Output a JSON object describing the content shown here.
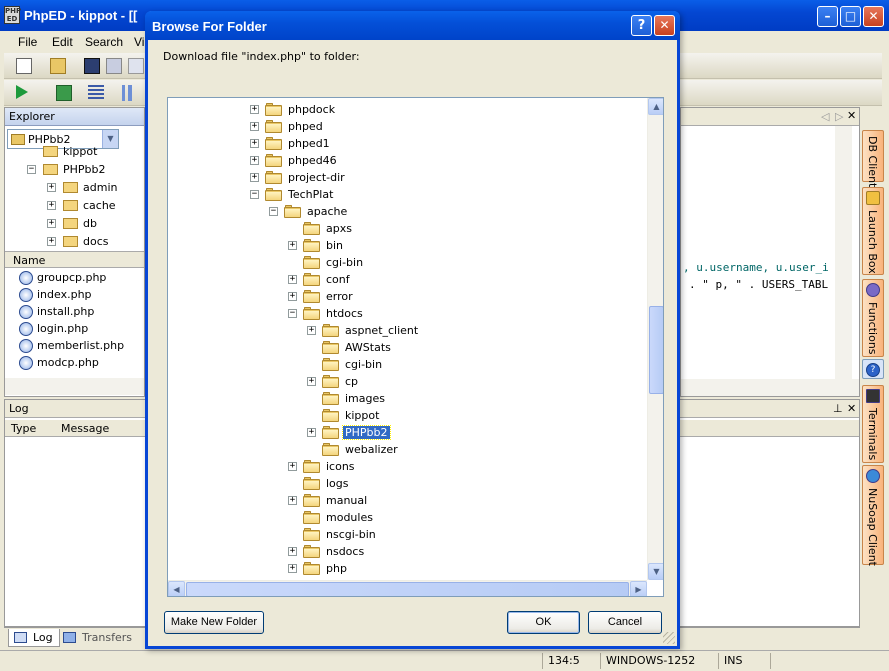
{
  "main_window": {
    "title": "PhpED - kippot - [[",
    "icon_text": "PHP\nED",
    "menu": [
      "File",
      "Edit",
      "Search",
      "Vi"
    ]
  },
  "explorer": {
    "title": "Explorer",
    "combo_value": "PHPbb2",
    "tree": [
      {
        "label": "kippot",
        "indent": 0,
        "toggle": ""
      },
      {
        "label": "PHPbb2",
        "indent": 0,
        "toggle": "-"
      },
      {
        "label": "admin",
        "indent": 1,
        "toggle": "+"
      },
      {
        "label": "cache",
        "indent": 1,
        "toggle": "+"
      },
      {
        "label": "db",
        "indent": 1,
        "toggle": "+"
      },
      {
        "label": "docs",
        "indent": 1,
        "toggle": "+"
      }
    ],
    "files_header": "Name",
    "files": [
      "groupcp.php",
      "index.php",
      "install.php",
      "login.php",
      "memberlist.php",
      "modcp.php"
    ]
  },
  "editor": {
    "code_lines": [
      ", u.username, u.user_i",
      ". \" p, \" . USERS_TABL"
    ]
  },
  "log": {
    "title": "Log",
    "columns": [
      "Type",
      "Message"
    ]
  },
  "bottom_tabs": [
    "Log",
    "Transfers"
  ],
  "side_tabs": [
    "DB Client",
    "Launch Box",
    "Functions",
    "Terminals",
    "NuSoap Client"
  ],
  "status": {
    "position": "134:5",
    "encoding": "WINDOWS-1252",
    "mode": "INS"
  },
  "dialog": {
    "title": "Browse For Folder",
    "prompt": "Download file \"index.php\" to folder:",
    "help_button": "?",
    "tree": [
      {
        "label": "phpdock",
        "level": 0,
        "toggle": "+"
      },
      {
        "label": "phped",
        "level": 0,
        "toggle": "+"
      },
      {
        "label": "phped1",
        "level": 0,
        "toggle": "+"
      },
      {
        "label": "phped46",
        "level": 0,
        "toggle": "+"
      },
      {
        "label": "project-dir",
        "level": 0,
        "toggle": "+"
      },
      {
        "label": "TechPlat",
        "level": 0,
        "toggle": "-"
      },
      {
        "label": "apache",
        "level": 1,
        "toggle": "-"
      },
      {
        "label": "apxs",
        "level": 2,
        "toggle": ""
      },
      {
        "label": "bin",
        "level": 2,
        "toggle": "+"
      },
      {
        "label": "cgi-bin",
        "level": 2,
        "toggle": ""
      },
      {
        "label": "conf",
        "level": 2,
        "toggle": "+"
      },
      {
        "label": "error",
        "level": 2,
        "toggle": "+"
      },
      {
        "label": "htdocs",
        "level": 2,
        "toggle": "-"
      },
      {
        "label": "aspnet_client",
        "level": 3,
        "toggle": "+"
      },
      {
        "label": "AWStats",
        "level": 3,
        "toggle": ""
      },
      {
        "label": "cgi-bin",
        "level": 3,
        "toggle": ""
      },
      {
        "label": "cp",
        "level": 3,
        "toggle": "+"
      },
      {
        "label": "images",
        "level": 3,
        "toggle": ""
      },
      {
        "label": "kippot",
        "level": 3,
        "toggle": ""
      },
      {
        "label": "PHPbb2",
        "level": 3,
        "toggle": "+",
        "selected": true
      },
      {
        "label": "webalizer",
        "level": 3,
        "toggle": ""
      },
      {
        "label": "icons",
        "level": 2,
        "toggle": "+"
      },
      {
        "label": "logs",
        "level": 2,
        "toggle": ""
      },
      {
        "label": "manual",
        "level": 2,
        "toggle": "+"
      },
      {
        "label": "modules",
        "level": 2,
        "toggle": ""
      },
      {
        "label": "nscgi-bin",
        "level": 2,
        "toggle": ""
      },
      {
        "label": "nsdocs",
        "level": 2,
        "toggle": "+"
      },
      {
        "label": "php",
        "level": 2,
        "toggle": "+"
      }
    ],
    "make_new_folder_label": "Make New Folder",
    "ok_label": "OK",
    "cancel_label": "Cancel"
  },
  "colors": {
    "titlebar": "#0450d8",
    "selection": "#316ac5",
    "dialog_bg": "#ece9d8"
  }
}
